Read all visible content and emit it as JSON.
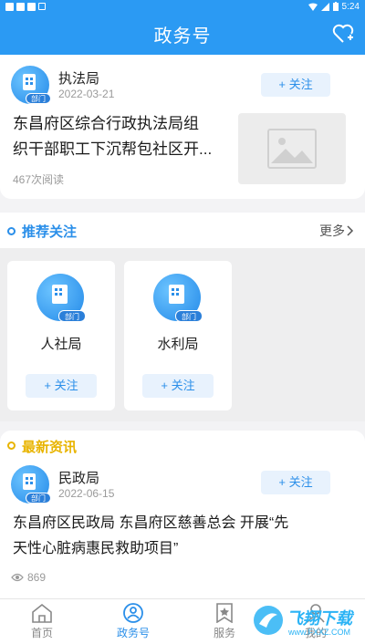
{
  "status_bar": {
    "time": "5:24"
  },
  "header": {
    "title": "政务号"
  },
  "top_article": {
    "org": "执法局",
    "date": "2022-03-21",
    "follow_label": "+ 关注",
    "avatar_tag": "部门",
    "title_line1": "东昌府区综合行政执法局组",
    "title_line2": "织干部职工下沉帮包社区开...",
    "reads": "467次阅读"
  },
  "recommend": {
    "title": "推荐关注",
    "more": "更多",
    "accent": "#2b8fe9",
    "items": [
      {
        "name": "人社局",
        "tag": "部门",
        "follow_label": "+ 关注"
      },
      {
        "name": "水利局",
        "tag": "部门",
        "follow_label": "+ 关注"
      }
    ]
  },
  "news": {
    "title": "最新资讯",
    "accent": "#e8b400",
    "org": "民政局",
    "date": "2022-06-15",
    "avatar_tag": "部门",
    "follow_label": "+ 关注",
    "title_line1": "东昌府区民政局 东昌府区慈善总会 开展“先",
    "title_line2": "天性心脏病惠民救助项目”",
    "views": "869"
  },
  "nav": {
    "items": [
      {
        "label": "首页",
        "icon": "home-icon"
      },
      {
        "label": "政务号",
        "icon": "gov-account-icon"
      },
      {
        "label": "服务",
        "icon": "service-icon"
      },
      {
        "label": "我的",
        "icon": "user-icon"
      }
    ]
  },
  "watermark": {
    "text": "飞翔下载",
    "url": "www.FXXZ.COM"
  }
}
